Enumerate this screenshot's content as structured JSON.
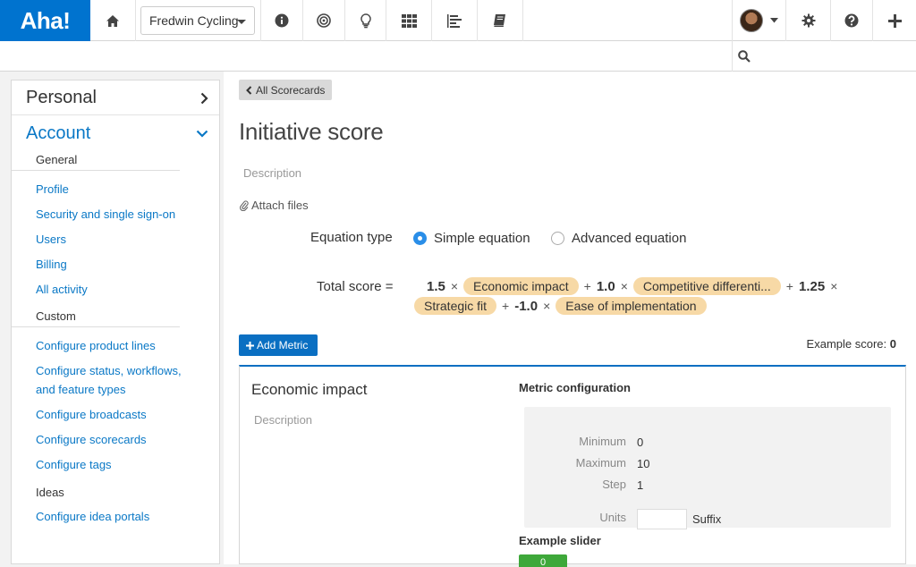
{
  "app": {
    "logo_text": "Aha!",
    "brand_color": "#0073cf"
  },
  "topnav": {
    "workspace": "Fredwin Cycling",
    "icons": [
      "home-icon",
      "info-icon",
      "target-icon",
      "lightbulb-icon",
      "grid-icon",
      "roadmap-icon",
      "book-icon"
    ],
    "right_icons": [
      "avatar",
      "gear-icon",
      "help-icon",
      "plus-icon"
    ]
  },
  "search": {
    "placeholder": ""
  },
  "sidebar": {
    "personal": "Personal",
    "account": "Account",
    "sections": [
      {
        "title": "General",
        "links": [
          "Profile",
          "Security and single sign-on",
          "Users",
          "Billing",
          "All activity"
        ]
      },
      {
        "title": "Custom",
        "links": [
          "Configure product lines",
          "Configure status, workflows, and feature types",
          "Configure broadcasts",
          "Configure scorecards",
          "Configure tags"
        ]
      },
      {
        "title": "Ideas",
        "links": [
          "Configure idea portals"
        ]
      }
    ]
  },
  "main": {
    "back_label": "All Scorecards",
    "title": "Initiative score",
    "description_placeholder": "Description",
    "attach_label": "Attach files",
    "equation_type_label": "Equation type",
    "equation_options": [
      "Simple equation",
      "Advanced equation"
    ],
    "equation_selected": "Simple equation",
    "total_score_label": "Total score =",
    "terms": [
      {
        "weight": "1.5",
        "metric": "Economic impact"
      },
      {
        "weight": "1.0",
        "metric": "Competitive differenti..."
      },
      {
        "weight": "1.25",
        "metric": "Strategic fit"
      },
      {
        "weight": "-1.0",
        "metric": "Ease of implementation"
      }
    ],
    "add_metric_label": "Add Metric",
    "example_score_label": "Example score:",
    "example_score_value": "0",
    "metric": {
      "name": "Economic impact",
      "description_placeholder": "Description",
      "config_heading": "Metric configuration",
      "minimum_label": "Minimum",
      "minimum": "0",
      "maximum_label": "Maximum",
      "maximum": "10",
      "step_label": "Step",
      "step": "1",
      "units_label": "Units",
      "units_value": "",
      "suffix_label": "Suffix",
      "slider_heading": "Example slider",
      "slider_value": "0"
    }
  }
}
